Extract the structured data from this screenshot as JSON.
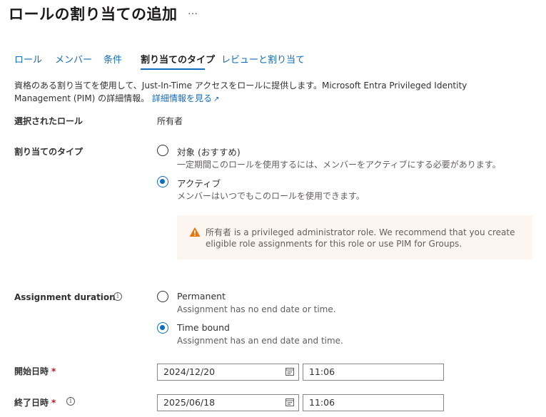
{
  "header": {
    "title": "ロールの割り当ての追加",
    "more_label": "…"
  },
  "tabs": [
    {
      "label": "ロール"
    },
    {
      "label": "メンバー"
    },
    {
      "label": "条件"
    },
    {
      "label": "割り当てのタイプ",
      "active": true
    },
    {
      "label": "レビューと割り当て"
    }
  ],
  "description": {
    "text": "資格のある割り当てを使用して、Just-In-Time アクセスをロールに提供します。Microsoft Entra Privileged Identity Management (PIM) の詳細情報。",
    "link": "詳細情報を見る"
  },
  "selected_role": {
    "label": "選択されたロール",
    "value": "所有者"
  },
  "assignment_type": {
    "label": "割り当てのタイプ",
    "options": [
      {
        "title": "対象 (おすすめ)",
        "subtitle": "一定期間このロールを使用するには、メンバーをアクティブにする必要があります。",
        "checked": false
      },
      {
        "title": "アクティブ",
        "subtitle": "メンバーはいつでもこのロールを使用できます。",
        "checked": true
      }
    ]
  },
  "warning": {
    "text": "所有者 is a privileged administrator role. We recommend that you create eligible role assignments for this role or use PIM for Groups."
  },
  "duration": {
    "label": "Assignment duration",
    "options": [
      {
        "title": "Permanent",
        "subtitle": "Assignment has no end date or time.",
        "checked": false
      },
      {
        "title": "Time bound",
        "subtitle": "Assignment has an end date and time.",
        "checked": true
      }
    ]
  },
  "start": {
    "label": "開始日時",
    "required": "*",
    "date": "2024/12/20",
    "time": "11:06"
  },
  "end": {
    "label": "終了日時",
    "required": "*",
    "date": "2025/06/18",
    "time": "11:06"
  },
  "colors": {
    "accent": "#0f6cbd",
    "warning": "#e8740c",
    "warning_bg": "#fdf6f0",
    "required": "#c50f1f"
  }
}
